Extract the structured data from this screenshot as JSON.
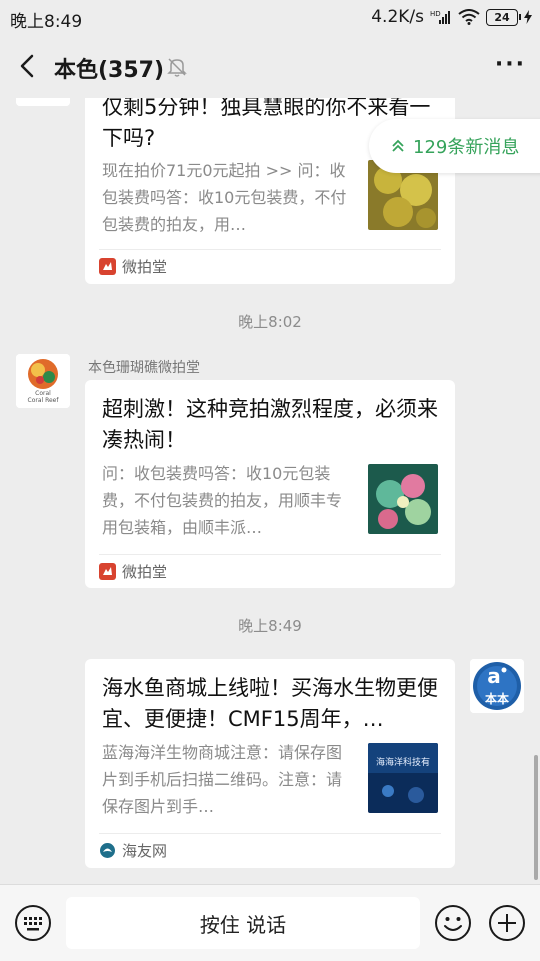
{
  "status_bar": {
    "time": "晚上8:49",
    "net_speed": "4.2K/s",
    "battery": "24"
  },
  "header": {
    "title": "本色(357)"
  },
  "new_messages": {
    "label": "129条新消息"
  },
  "messages": [
    {
      "title": "仅剩5分钟！独具慧眼的你不来看一下吗?",
      "desc": "现在拍价71元0元起拍 >> 问：收包装费吗答：收10元包装费，不付包装费的拍友，用…",
      "source": "微拍堂"
    },
    {
      "timestamp": "晚上8:02",
      "sender": "本色珊瑚礁微拍堂",
      "title": "超刺激！这种竞拍激烈程度，必须来凑热闹！",
      "desc": "问：收包装费吗答：收10元包装费，不付包装费的拍友，用顺丰专用包装箱，由顺丰派…",
      "source": "微拍堂"
    },
    {
      "timestamp": "晚上8:49",
      "title": "海水鱼商城上线啦！买海水生物更便宜、更便捷！CMF15周年，…",
      "desc": "蓝海海洋生物商城注意：请保存图片到手机后扫描二维码。注意：请保存图片到手…",
      "source": "海友网",
      "thumb_text": "海海洋科技有"
    }
  ],
  "avatar_text": {
    "coral_top": "Coral",
    "coral_bottom": "Coral Reef",
    "self_badge": "本本"
  },
  "input_bar": {
    "hold_to_talk": "按住 说话"
  },
  "colors": {
    "background": "#ededed",
    "accent_green": "#36a35b",
    "source_red": "#d8432f"
  }
}
